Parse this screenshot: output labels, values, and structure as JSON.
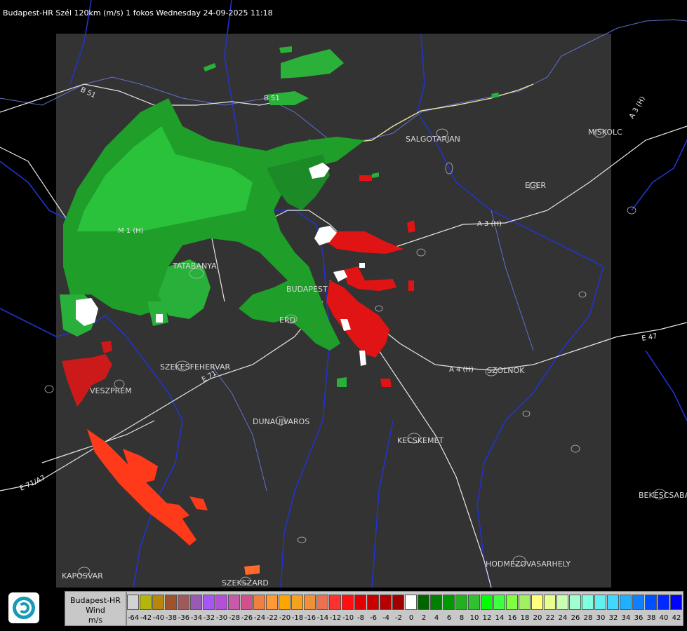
{
  "header": {
    "title": "Budapest-HR Szél 120km (m/s) 1 fokos Wednesday 24-09-2025 11:18"
  },
  "cities": {
    "salgotarjan": "SALGOTARJAN",
    "miskolc": "MISKOLC",
    "eger": "EGER",
    "tatabanya": "TATABANYA",
    "budapest": "BUDAPEST",
    "erd": "ERD",
    "szekesfehervar": "SZEKESFEHERVAR",
    "veszprem": "VESZPREM",
    "szolnok": "SZOLNOK",
    "dunaujvaros": "DUNAUJVAROS",
    "kecskemet": "KECSKEMET",
    "bekescsaba": "BEKESCSABA",
    "hodmezovasarhely": "HODMEZOVASARHELY",
    "kaposvar": "KAPOSVAR",
    "szekszard": "SZEKSZARD"
  },
  "roads": {
    "b51_upper": "B 51",
    "b51": "B 51",
    "m1": "M 1 (H)",
    "a3": "A 3 (H)",
    "a3_ne": "A 3 (H)",
    "a4": "A 4 (H)",
    "e71": "E 71",
    "e47": "E 47",
    "e71_sw": "E 71/A7"
  },
  "legend": {
    "line1": "Budapest-HR",
    "line2": "Wind",
    "line3": "m/s",
    "ticks": [
      "-64",
      "-42",
      "-40",
      "-38",
      "-36",
      "-34",
      "-32",
      "-30",
      "-28",
      "-26",
      "-24",
      "-22",
      "-20",
      "-18",
      "-16",
      "-14",
      "-12",
      "-10",
      "-8",
      "-6",
      "-4",
      "-2",
      "0",
      "2",
      "4",
      "6",
      "8",
      "10",
      "12",
      "14",
      "16",
      "18",
      "20",
      "22",
      "24",
      "26",
      "28",
      "30",
      "32",
      "34",
      "36",
      "38",
      "40",
      "42"
    ],
    "colors": [
      "#d3d3d3",
      "#b5b50c",
      "#b8860b",
      "#a0522d",
      "#9e5a5a",
      "#9b59b6",
      "#a855f7",
      "#b450d8",
      "#c85aaa",
      "#d2508c",
      "#ee8040",
      "#ff9933",
      "#ffa500",
      "#f4a020",
      "#f0903a",
      "#ec7050",
      "#ff3030",
      "#ff1010",
      "#e00000",
      "#c80000",
      "#b40000",
      "#a00000",
      "#ffffff",
      "#006400",
      "#008000",
      "#009a00",
      "#20b020",
      "#30c030",
      "#00ff00",
      "#40ff40",
      "#80ff40",
      "#a0f060",
      "#ffff80",
      "#e8ff90",
      "#c8ffb0",
      "#a0ffd0",
      "#80ffe0",
      "#60f0f0",
      "#40d8ff",
      "#20b0ff",
      "#1080ff",
      "#0050ff",
      "#0028ff",
      "#0000ff"
    ]
  }
}
